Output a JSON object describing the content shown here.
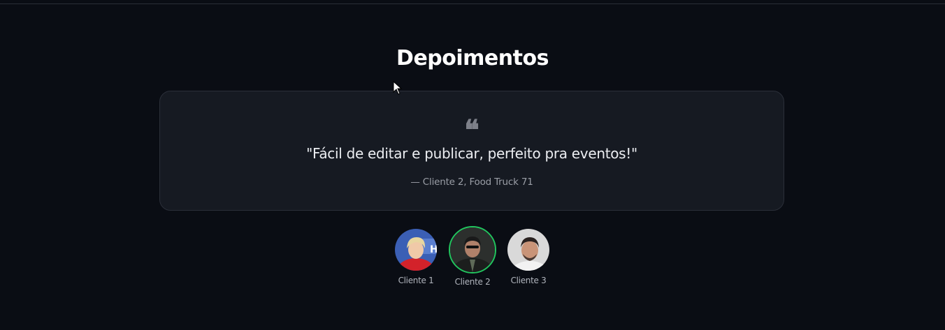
{
  "section": {
    "title": "Depoimentos"
  },
  "testimonial": {
    "quote_icon": "quote-icon",
    "text": "\"Fácil de editar e publicar, perfeito pra eventos!\"",
    "author": "— Cliente 2, Food Truck 71"
  },
  "clients": [
    {
      "label": "Cliente 1",
      "active": false
    },
    {
      "label": "Cliente 2",
      "active": true
    },
    {
      "label": "Cliente 3",
      "active": false
    }
  ],
  "colors": {
    "background": "#0a0d14",
    "card": "#161a22",
    "active_ring": "#22c55e"
  }
}
